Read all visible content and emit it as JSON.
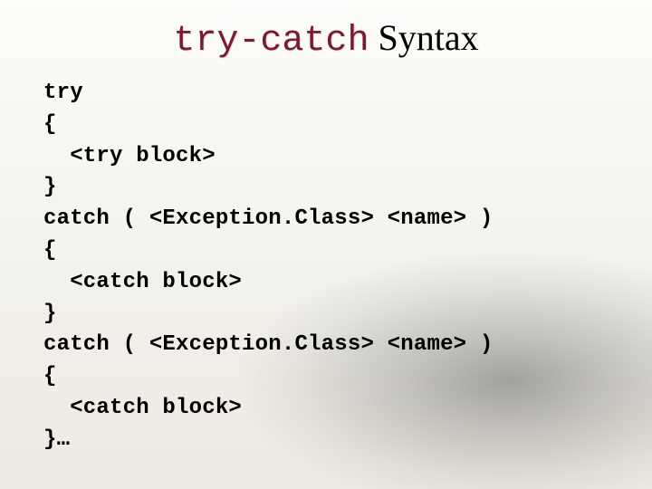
{
  "title": {
    "mono": "try-catch",
    "serif": " Syntax"
  },
  "code": {
    "l1": "try",
    "l2": "{",
    "l3": "  <try block>",
    "l4": "}",
    "l5": "catch ( <Exception.Class> <name> )",
    "l6": "{",
    "l7": "  <catch block>",
    "l8": "}",
    "l9": "catch ( <Exception.Class> <name> )",
    "l10": "{",
    "l11": "  <catch block>",
    "l12": "}…"
  }
}
